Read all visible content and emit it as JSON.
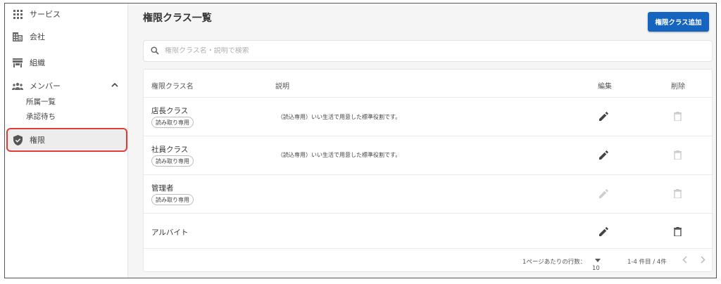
{
  "sidebar": {
    "items": [
      {
        "label": "サービス",
        "icon": "grid-icon"
      },
      {
        "label": "会社",
        "icon": "building-icon"
      },
      {
        "label": "組織",
        "icon": "store-icon"
      },
      {
        "label": "メンバー",
        "icon": "group-icon",
        "expanded": true,
        "children": [
          {
            "label": "所属一覧"
          },
          {
            "label": "承認待ち"
          }
        ]
      },
      {
        "label": "権限",
        "icon": "shield-icon",
        "active": true
      }
    ]
  },
  "header": {
    "title": "権限クラス一覧",
    "add_button": "権限クラス追加"
  },
  "search": {
    "placeholder": "権限クラス名・説明で検索",
    "value": ""
  },
  "table": {
    "headers": {
      "name": "権限クラス名",
      "description": "説明",
      "edit": "編集",
      "delete": "削除"
    },
    "rows": [
      {
        "name": "店長クラス",
        "badge": "読み取り専用",
        "description": "（読込専用）いい生活で用意した標準役割です。",
        "edit_enabled": true,
        "delete_enabled": false
      },
      {
        "name": "社員クラス",
        "badge": "読み取り専用",
        "description": "（読込専用）いい生活で用意した標準役割です。",
        "edit_enabled": true,
        "delete_enabled": false
      },
      {
        "name": "管理者",
        "badge": "読み取り専用",
        "description": "",
        "edit_enabled": false,
        "delete_enabled": false
      },
      {
        "name": "アルバイト",
        "badge": "",
        "description": "",
        "edit_enabled": true,
        "delete_enabled": true
      }
    ]
  },
  "pagination": {
    "rows_per_page_label": "1ページあたりの行数：",
    "rows_per_page": "10",
    "range": "1-4 件目 / 4件"
  },
  "colors": {
    "accent": "#1565c0",
    "highlight": "#e53935"
  }
}
